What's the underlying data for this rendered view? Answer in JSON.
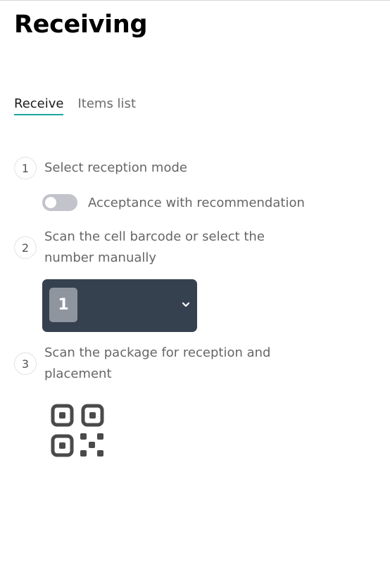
{
  "page": {
    "title": "Receiving"
  },
  "tabs": [
    {
      "label": "Receive",
      "active": true
    },
    {
      "label": "Items list",
      "active": false
    }
  ],
  "steps": [
    {
      "number": "1",
      "text": "Select reception mode"
    },
    {
      "number": "2",
      "text": "Scan the cell barcode or select the number manually"
    },
    {
      "number": "3",
      "text": "Scan the package for reception and placement"
    }
  ],
  "toggle": {
    "label": "Acceptance with recommendation",
    "state": "off"
  },
  "cell_select": {
    "value": "1",
    "icon": "chevron-down-icon"
  },
  "scan_icon": "qr-code-icon",
  "colors": {
    "accent": "#1aa79e",
    "select_bg": "#364150",
    "badge_bg": "#8f959e",
    "toggle_bg": "#c2c3cb"
  }
}
